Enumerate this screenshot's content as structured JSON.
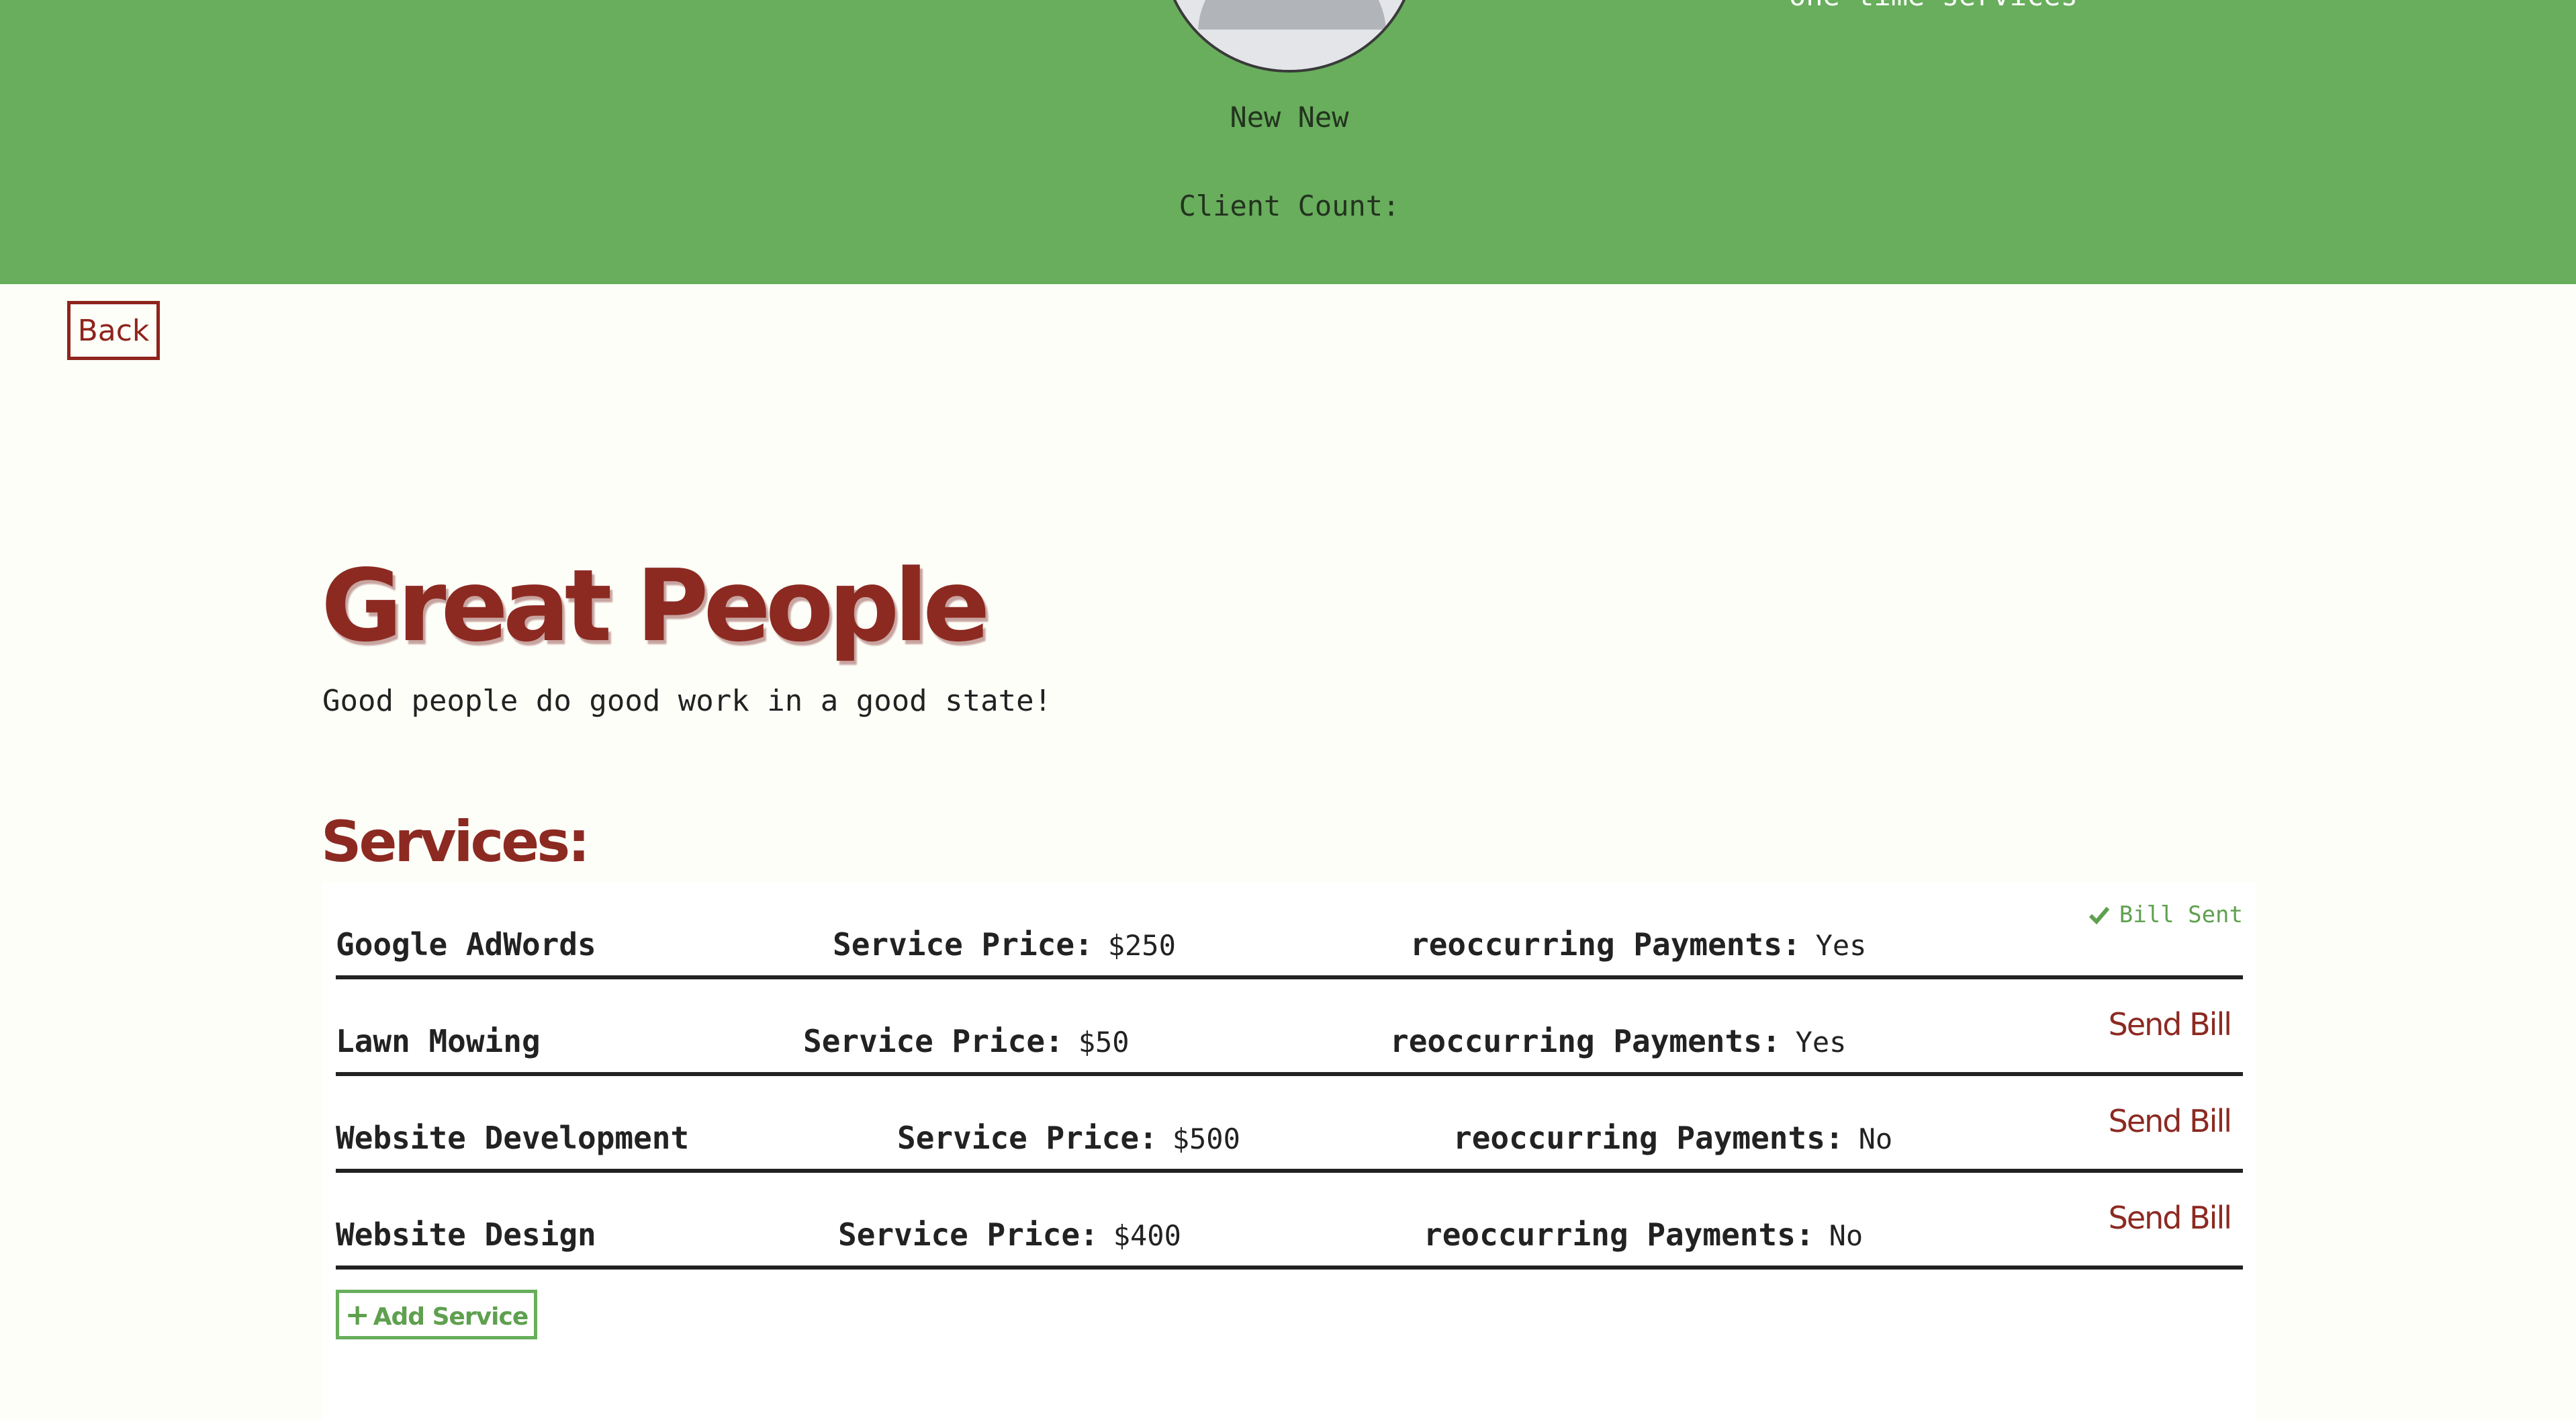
{
  "header": {
    "user_name": "New New",
    "client_count_label": "Client Count:",
    "service_types": [
      "one time services"
    ],
    "background_color": "#68ae5c"
  },
  "back_label": "Back",
  "company": {
    "name": "Great People",
    "tagline": "Good people do good work in a good state!"
  },
  "services_heading": "Services:",
  "price_label": "Service Price:",
  "recurring_label": "reoccurring Payments:",
  "services": [
    {
      "name": "Google AdWords",
      "price": "$250",
      "recurring": "Yes",
      "status": "Bill Sent"
    },
    {
      "name": "Lawn Mowing",
      "price": "$50",
      "recurring": "Yes",
      "action": "Send Bill"
    },
    {
      "name": "Website Development",
      "price": "$500",
      "recurring": "No",
      "action": "Send Bill"
    },
    {
      "name": "Website Design",
      "price": "$400",
      "recurring": "No",
      "action": "Send Bill"
    }
  ],
  "add_service_label": "Add Service",
  "icons": {
    "check": "check-icon",
    "plus": "plus-icon",
    "avatar": "avatar-placeholder"
  },
  "colors": {
    "accent_red": "#8c2a22",
    "accent_green": "#68ae5c"
  }
}
